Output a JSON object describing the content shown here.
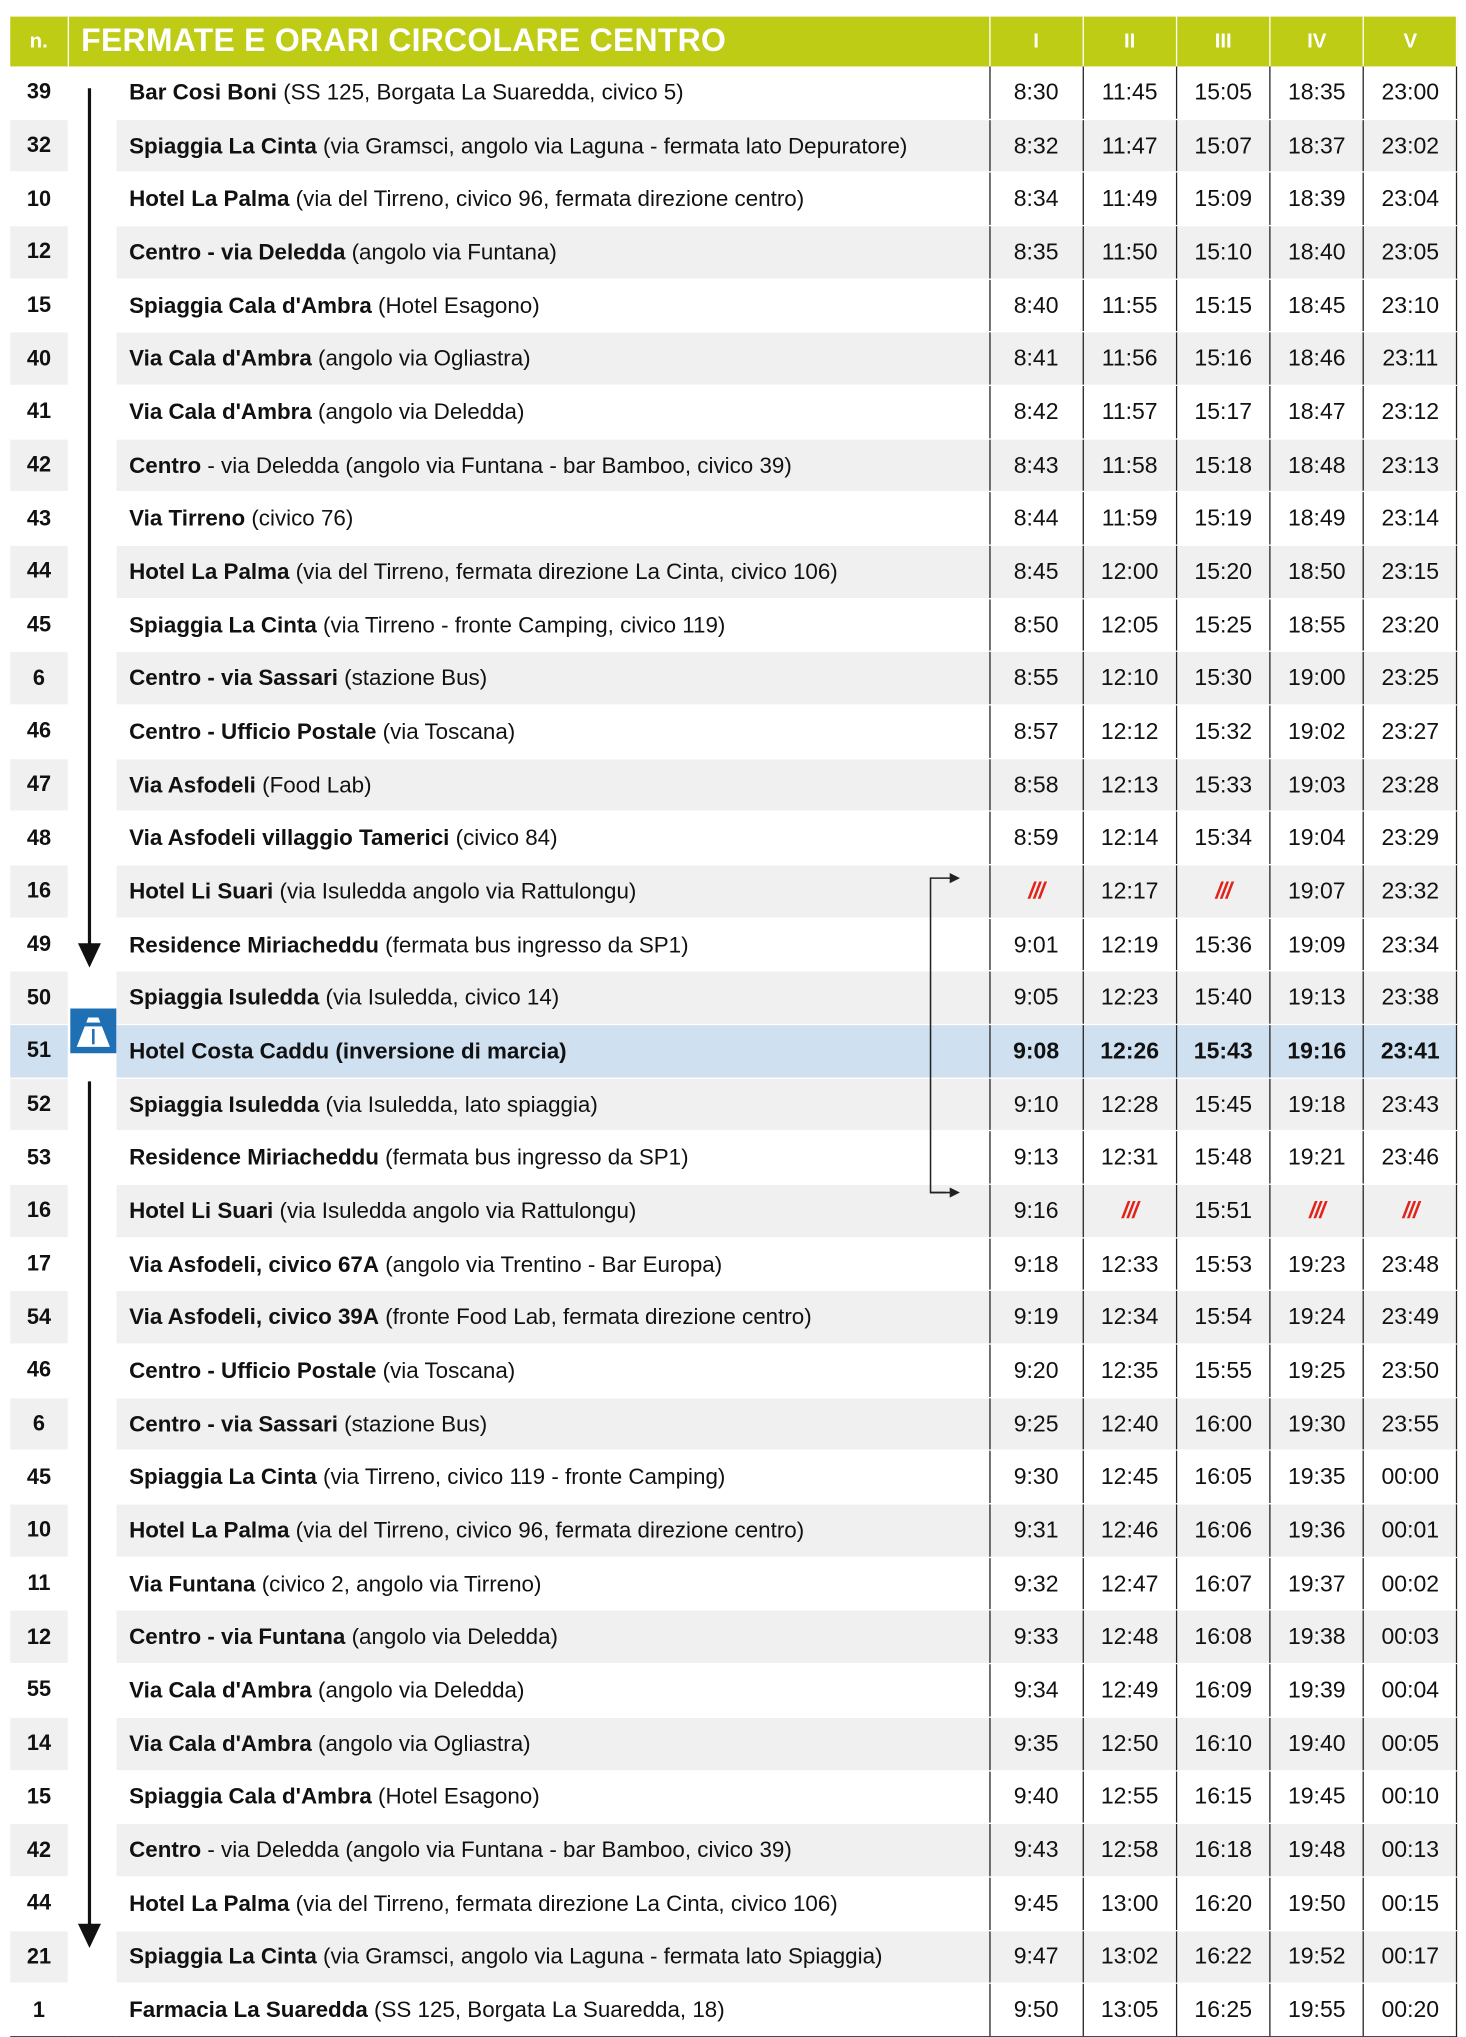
{
  "header": {
    "n_label": "n.",
    "title": "FERMATE E ORARI CIRCOLARE CENTRO",
    "runs": [
      "I",
      "II",
      "III",
      "IV",
      "V"
    ]
  },
  "skip_mark": "///",
  "colors": {
    "header_bg": "#bfcc16",
    "highlight_row": "#cfe0f0",
    "skip_red": "#e2231a",
    "icon_blue": "#1f6fb4"
  },
  "icons": {
    "direction_arrow": "arrow-down-icon",
    "turnaround": "road-icon",
    "loop": "bracket-arrow-icon"
  },
  "stops": [
    {
      "n": "39",
      "name": "Bar Cosi Boni",
      "detail": " (SS 125, Borgata La Suaredda, civico 5)",
      "times": [
        "8:30",
        "11:45",
        "15:05",
        "18:35",
        "23:00"
      ]
    },
    {
      "n": "32",
      "name": "Spiaggia La Cinta",
      "detail": " (via Gramsci, angolo via Laguna - fermata lato Depuratore)",
      "times": [
        "8:32",
        "11:47",
        "15:07",
        "18:37",
        "23:02"
      ]
    },
    {
      "n": "10",
      "name": "Hotel La Palma",
      "detail": " (via del Tirreno, civico 96, fermata direzione centro)",
      "times": [
        "8:34",
        "11:49",
        "15:09",
        "18:39",
        "23:04"
      ]
    },
    {
      "n": "12",
      "name": "Centro - via Deledda",
      "detail": " (angolo via Funtana)",
      "times": [
        "8:35",
        "11:50",
        "15:10",
        "18:40",
        "23:05"
      ]
    },
    {
      "n": "15",
      "name": "Spiaggia Cala d'Ambra",
      "detail": " (Hotel Esagono)",
      "times": [
        "8:40",
        "11:55",
        "15:15",
        "18:45",
        "23:10"
      ]
    },
    {
      "n": "40",
      "name": "Via Cala d'Ambra",
      "detail": " (angolo via Ogliastra)",
      "times": [
        "8:41",
        "11:56",
        "15:16",
        "18:46",
        "23:11"
      ]
    },
    {
      "n": "41",
      "name": "Via Cala d'Ambra",
      "detail": " (angolo via Deledda)",
      "times": [
        "8:42",
        "11:57",
        "15:17",
        "18:47",
        "23:12"
      ]
    },
    {
      "n": "42",
      "name": "Centro",
      "detail": " - via Deledda (angolo via Funtana - bar Bamboo, civico 39)",
      "times": [
        "8:43",
        "11:58",
        "15:18",
        "18:48",
        "23:13"
      ]
    },
    {
      "n": "43",
      "name": "Via Tirreno",
      "detail": " (civico 76)",
      "times": [
        "8:44",
        "11:59",
        "15:19",
        "18:49",
        "23:14"
      ]
    },
    {
      "n": "44",
      "name": "Hotel La Palma",
      "detail": " (via del Tirreno, fermata direzione La Cinta, civico 106)",
      "times": [
        "8:45",
        "12:00",
        "15:20",
        "18:50",
        "23:15"
      ]
    },
    {
      "n": "45",
      "name": "Spiaggia La Cinta",
      "detail": " (via Tirreno - fronte Camping, civico 119)",
      "times": [
        "8:50",
        "12:05",
        "15:25",
        "18:55",
        "23:20"
      ]
    },
    {
      "n": "6",
      "name": "Centro - via Sassari",
      "detail": " (stazione Bus)",
      "times": [
        "8:55",
        "12:10",
        "15:30",
        "19:00",
        "23:25"
      ]
    },
    {
      "n": "46",
      "name": "Centro - Ufficio Postale",
      "detail": " (via Toscana)",
      "times": [
        "8:57",
        "12:12",
        "15:32",
        "19:02",
        "23:27"
      ]
    },
    {
      "n": "47",
      "name": "Via Asfodeli",
      "detail": " (Food Lab)",
      "times": [
        "8:58",
        "12:13",
        "15:33",
        "19:03",
        "23:28"
      ]
    },
    {
      "n": "48",
      "name": "Via Asfodeli villaggio Tamerici",
      "detail": " (civico 84)",
      "times": [
        "8:59",
        "12:14",
        "15:34",
        "19:04",
        "23:29"
      ]
    },
    {
      "n": "16",
      "name": "Hotel Li Suari",
      "detail": " (via Isuledda angolo via Rattulongu)",
      "times": [
        "///",
        "12:17",
        "///",
        "19:07",
        "23:32"
      ]
    },
    {
      "n": "49",
      "name": "Residence Miriacheddu",
      "detail": " (fermata bus ingresso da SP1)",
      "times": [
        "9:01",
        "12:19",
        "15:36",
        "19:09",
        "23:34"
      ]
    },
    {
      "n": "50",
      "name": "Spiaggia Isuledda",
      "detail": " (via Isuledda, civico 14)",
      "times": [
        "9:05",
        "12:23",
        "15:40",
        "19:13",
        "23:38"
      ]
    },
    {
      "n": "51",
      "name": "Hotel Costa Caddu (inversione di marcia)",
      "detail": "",
      "times": [
        "9:08",
        "12:26",
        "15:43",
        "19:16",
        "23:41"
      ]
    },
    {
      "n": "52",
      "name": "Spiaggia Isuledda",
      "detail": " (via Isuledda, lato spiaggia)",
      "times": [
        "9:10",
        "12:28",
        "15:45",
        "19:18",
        "23:43"
      ]
    },
    {
      "n": "53",
      "name": "Residence Miriacheddu",
      "detail": " (fermata bus ingresso da SP1)",
      "times": [
        "9:13",
        "12:31",
        "15:48",
        "19:21",
        "23:46"
      ]
    },
    {
      "n": "16",
      "name": "Hotel Li Suari",
      "detail": " (via Isuledda angolo via Rattulongu)",
      "times": [
        "9:16",
        "///",
        "15:51",
        "///",
        "///"
      ]
    },
    {
      "n": "17",
      "name": "Via Asfodeli, civico 67A",
      "detail": " (angolo via Trentino - Bar Europa)",
      "times": [
        "9:18",
        "12:33",
        "15:53",
        "19:23",
        "23:48"
      ]
    },
    {
      "n": "54",
      "name": "Via Asfodeli, civico 39A",
      "detail": " (fronte Food Lab, fermata direzione centro)",
      "times": [
        "9:19",
        "12:34",
        "15:54",
        "19:24",
        "23:49"
      ]
    },
    {
      "n": "46",
      "name": "Centro - Ufficio Postale",
      "detail": " (via Toscana)",
      "times": [
        "9:20",
        "12:35",
        "15:55",
        "19:25",
        "23:50"
      ]
    },
    {
      "n": "6",
      "name": "Centro - via Sassari",
      "detail": " (stazione Bus)",
      "times": [
        "9:25",
        "12:40",
        "16:00",
        "19:30",
        "23:55"
      ]
    },
    {
      "n": "45",
      "name": "Spiaggia La Cinta",
      "detail": " (via Tirreno, civico 119 - fronte Camping)",
      "times": [
        "9:30",
        "12:45",
        "16:05",
        "19:35",
        "00:00"
      ]
    },
    {
      "n": "10",
      "name": "Hotel La Palma",
      "detail": " (via del Tirreno, civico 96, fermata direzione centro)",
      "times": [
        "9:31",
        "12:46",
        "16:06",
        "19:36",
        "00:01"
      ]
    },
    {
      "n": "11",
      "name": "Via Funtana",
      "detail": " (civico 2, angolo via Tirreno)",
      "times": [
        "9:32",
        "12:47",
        "16:07",
        "19:37",
        "00:02"
      ]
    },
    {
      "n": "12",
      "name": "Centro - via Funtana",
      "detail": " (angolo via Deledda)",
      "times": [
        "9:33",
        "12:48",
        "16:08",
        "19:38",
        "00:03"
      ]
    },
    {
      "n": "55",
      "name": "Via Cala d'Ambra",
      "detail": " (angolo via Deledda)",
      "times": [
        "9:34",
        "12:49",
        "16:09",
        "19:39",
        "00:04"
      ]
    },
    {
      "n": "14",
      "name": "Via Cala d'Ambra",
      "detail": " (angolo via Ogliastra)",
      "times": [
        "9:35",
        "12:50",
        "16:10",
        "19:40",
        "00:05"
      ]
    },
    {
      "n": "15",
      "name": "Spiaggia Cala d'Ambra",
      "detail": " (Hotel Esagono)",
      "times": [
        "9:40",
        "12:55",
        "16:15",
        "19:45",
        "00:10"
      ]
    },
    {
      "n": "42",
      "name": "Centro",
      "detail": " - via Deledda (angolo via Funtana - bar Bamboo, civico 39)",
      "times": [
        "9:43",
        "12:58",
        "16:18",
        "19:48",
        "00:13"
      ]
    },
    {
      "n": "44",
      "name": "Hotel La Palma",
      "detail": " (via del Tirreno, fermata direzione La Cinta, civico 106)",
      "times": [
        "9:45",
        "13:00",
        "16:20",
        "19:50",
        "00:15"
      ]
    },
    {
      "n": "21",
      "name": "Spiaggia La Cinta",
      "detail": " (via Gramsci, angolo via Laguna - fermata lato Spiaggia)",
      "times": [
        "9:47",
        "13:02",
        "16:22",
        "19:52",
        "00:17"
      ]
    },
    {
      "n": "1",
      "name": "Farmacia La Suaredda",
      "detail": " (SS 125, Borgata La Suaredda, 18)",
      "times": [
        "9:50",
        "13:05",
        "16:25",
        "19:55",
        "00:20"
      ]
    }
  ]
}
